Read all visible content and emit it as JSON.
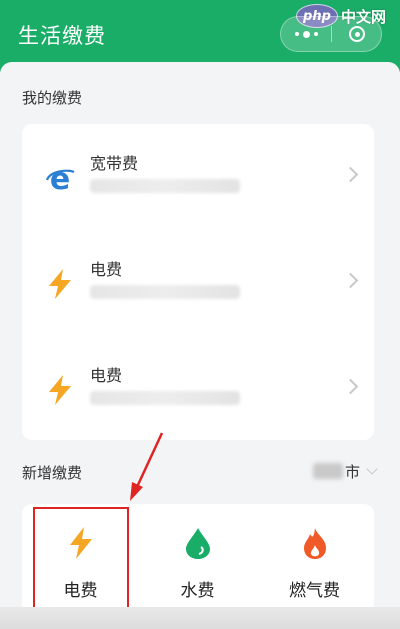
{
  "header": {
    "title": "生活缴费"
  },
  "watermark": {
    "logo": "php",
    "text": "中文网"
  },
  "my_payments": {
    "title": "我的缴费",
    "items": [
      {
        "name": "宽带费",
        "icon": "ie-browser-icon"
      },
      {
        "name": "电费",
        "icon": "lightning-icon"
      },
      {
        "name": "电费",
        "icon": "lightning-icon"
      }
    ]
  },
  "add_payment": {
    "title": "新增缴费",
    "city_suffix": "市",
    "items": [
      {
        "label": "电费",
        "icon": "lightning-icon"
      },
      {
        "label": "水费",
        "icon": "water-drop-icon"
      },
      {
        "label": "燃气费",
        "icon": "flame-icon"
      }
    ]
  },
  "colors": {
    "brand": "#1aad68",
    "lightning": "#f5a623",
    "water": "#1aad68",
    "flame": "#f05a28",
    "annotation": "#e02424"
  }
}
